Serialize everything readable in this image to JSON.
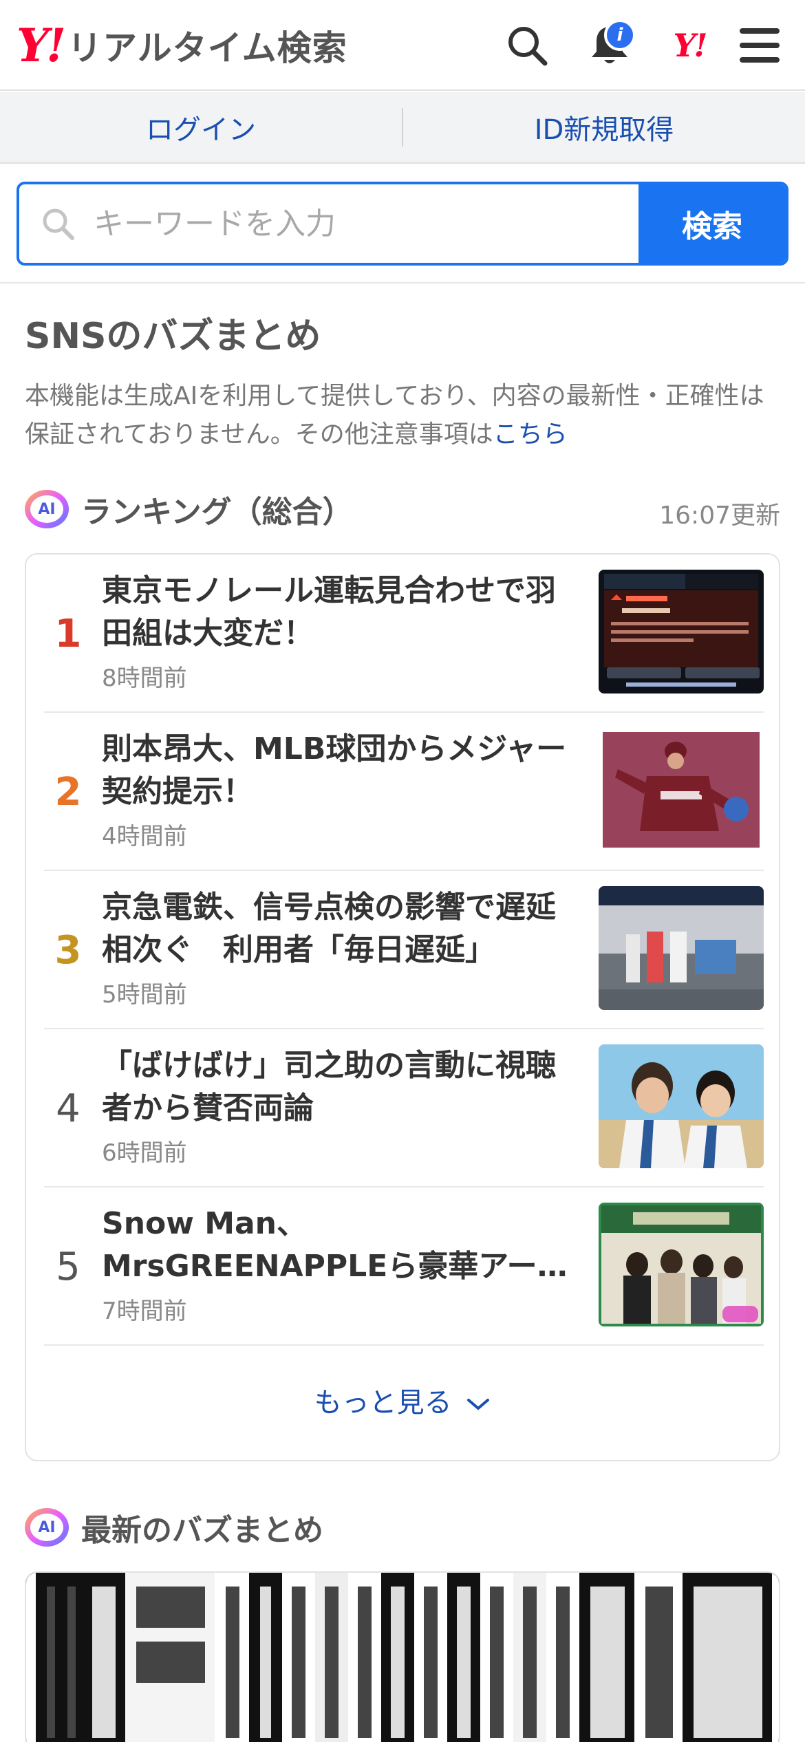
{
  "header": {
    "logo_mark": "Y!",
    "logo_text": "リアルタイム検索",
    "notification_badge": "i",
    "yj_mark": "Y!"
  },
  "login_bar": {
    "login": "ログイン",
    "register": "ID新規取得"
  },
  "search": {
    "placeholder": "キーワードを入力",
    "button": "検索"
  },
  "section": {
    "title": "SNSのバズまとめ",
    "notice_text": "本機能は生成AIを利用して提供しており、内容の最新性・正確性は保証されておりません。その他注意事項は",
    "notice_link": "こちら"
  },
  "ranking": {
    "ai_label": "AI",
    "title": "ランキング（総合）",
    "updated": "16:07更新",
    "items": [
      {
        "rank": "1",
        "title": "東京モノレール運転見合わせで羽田組は大変だ！",
        "time": "8時間前",
        "rank_color": "#d93a2b"
      },
      {
        "rank": "2",
        "title": "則本昂大、MLB球団からメジャー契約提示！",
        "time": "4時間前",
        "rank_color": "#e8742a"
      },
      {
        "rank": "3",
        "title": "京急電鉄、信号点検の影響で遅延相次ぐ　利用者「毎日遅延」",
        "time": "5時間前",
        "rank_color": "#c49420"
      },
      {
        "rank": "4",
        "title": "「ばけばけ」司之助の言動に視聴者から賛否両論",
        "time": "6時間前",
        "rank_color": "#555555"
      },
      {
        "rank": "5",
        "title": "Snow Man、MrsGREENAPPLEら豪華アー…",
        "time": "7時間前",
        "rank_color": "#555555"
      }
    ],
    "more": "もっと見る"
  },
  "latest": {
    "ai_label": "AI",
    "title": "最新のバズまとめ"
  },
  "colors": {
    "accent": "#1a73f0",
    "link": "#1a4fb0",
    "brand": "#ff0033"
  }
}
